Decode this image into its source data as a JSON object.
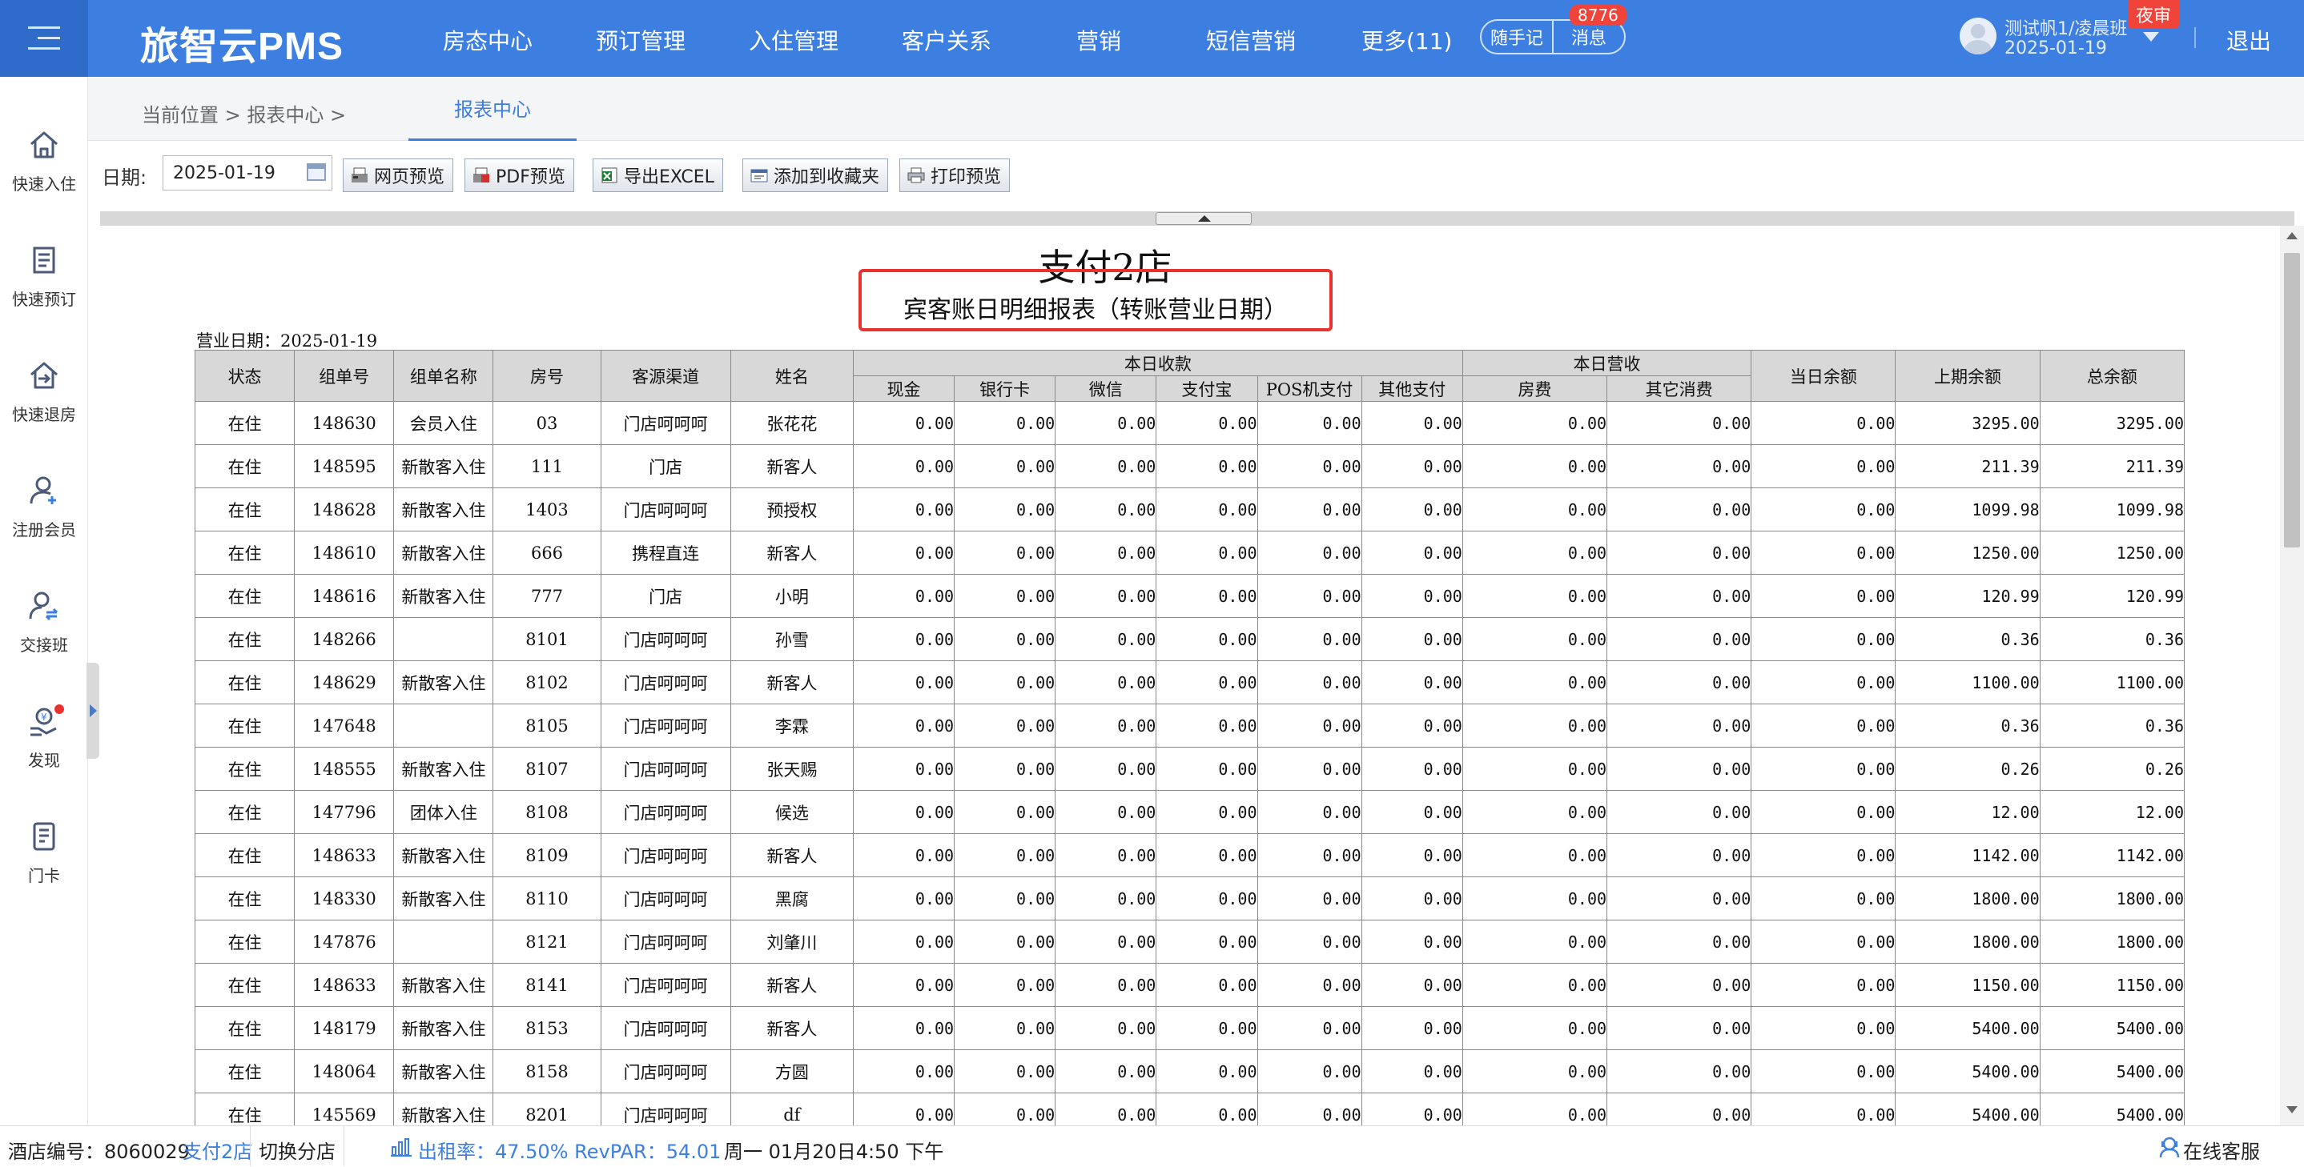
{
  "brand": "旅智云PMS",
  "nav": [
    "房态中心",
    "预订管理",
    "入住管理",
    "客户关系",
    "营销",
    "短信营销",
    "更多(11)"
  ],
  "quick_note": "随手记",
  "messages": {
    "label": "消息",
    "badge": "8776"
  },
  "user": {
    "name": "测试帆1/凌晨班",
    "date": "2025-01-19",
    "badge": "夜审"
  },
  "logout": "退出",
  "sidebar": [
    {
      "label": "快速入住",
      "icon": "home-icon"
    },
    {
      "label": "快速预订",
      "icon": "document-icon"
    },
    {
      "label": "快速退房",
      "icon": "checkout-icon"
    },
    {
      "label": "注册会员",
      "icon": "add-user-icon"
    },
    {
      "label": "交接班",
      "icon": "handover-icon"
    },
    {
      "label": "发现",
      "icon": "discover-icon"
    },
    {
      "label": "门卡",
      "icon": "card-icon"
    }
  ],
  "breadcrumb": {
    "text": "当前位置 > 报表中心 >",
    "active_tab": "报表中心"
  },
  "toolbar": {
    "date_label": "日期:",
    "date_value": "2025-01-19",
    "buttons": [
      "网页预览",
      "PDF预览",
      "导出EXCEL",
      "添加到收藏夹",
      "打印预览"
    ]
  },
  "report": {
    "title": "支付2店",
    "subtitle": "宾客账日明细报表（转账营业日期）",
    "business_date": "营业日期：2025-01-19",
    "group_headers": {
      "receipts": "本日收款",
      "revenue": "本日营收"
    },
    "columns": [
      "状态",
      "组单号",
      "组单名称",
      "房号",
      "客源渠道",
      "姓名",
      "现金",
      "银行卡",
      "微信",
      "支付宝",
      "POS机支付",
      "其他支付",
      "房费",
      "其它消费",
      "当日余额",
      "上期余额",
      "总余额"
    ],
    "rows": [
      [
        "在住",
        "148630",
        "会员入住",
        "03",
        "门店呵呵呵",
        "张花花",
        "0.00",
        "0.00",
        "0.00",
        "0.00",
        "0.00",
        "0.00",
        "0.00",
        "0.00",
        "0.00",
        "3295.00",
        "3295.00"
      ],
      [
        "在住",
        "148595",
        "新散客入住",
        "111",
        "门店",
        "新客人",
        "0.00",
        "0.00",
        "0.00",
        "0.00",
        "0.00",
        "0.00",
        "0.00",
        "0.00",
        "0.00",
        "211.39",
        "211.39"
      ],
      [
        "在住",
        "148628",
        "新散客入住",
        "1403",
        "门店呵呵呵",
        "预授权",
        "0.00",
        "0.00",
        "0.00",
        "0.00",
        "0.00",
        "0.00",
        "0.00",
        "0.00",
        "0.00",
        "1099.98",
        "1099.98"
      ],
      [
        "在住",
        "148610",
        "新散客入住",
        "666",
        "携程直连",
        "新客人",
        "0.00",
        "0.00",
        "0.00",
        "0.00",
        "0.00",
        "0.00",
        "0.00",
        "0.00",
        "0.00",
        "1250.00",
        "1250.00"
      ],
      [
        "在住",
        "148616",
        "新散客入住",
        "777",
        "门店",
        "小明",
        "0.00",
        "0.00",
        "0.00",
        "0.00",
        "0.00",
        "0.00",
        "0.00",
        "0.00",
        "0.00",
        "120.99",
        "120.99"
      ],
      [
        "在住",
        "148266",
        "",
        "8101",
        "门店呵呵呵",
        "孙雪",
        "0.00",
        "0.00",
        "0.00",
        "0.00",
        "0.00",
        "0.00",
        "0.00",
        "0.00",
        "0.00",
        "0.36",
        "0.36"
      ],
      [
        "在住",
        "148629",
        "新散客入住",
        "8102",
        "门店呵呵呵",
        "新客人",
        "0.00",
        "0.00",
        "0.00",
        "0.00",
        "0.00",
        "0.00",
        "0.00",
        "0.00",
        "0.00",
        "1100.00",
        "1100.00"
      ],
      [
        "在住",
        "147648",
        "",
        "8105",
        "门店呵呵呵",
        "李霖",
        "0.00",
        "0.00",
        "0.00",
        "0.00",
        "0.00",
        "0.00",
        "0.00",
        "0.00",
        "0.00",
        "0.36",
        "0.36"
      ],
      [
        "在住",
        "148555",
        "新散客入住",
        "8107",
        "门店呵呵呵",
        "张天赐",
        "0.00",
        "0.00",
        "0.00",
        "0.00",
        "0.00",
        "0.00",
        "0.00",
        "0.00",
        "0.00",
        "0.26",
        "0.26"
      ],
      [
        "在住",
        "147796",
        "团体入住",
        "8108",
        "门店呵呵呵",
        "候选",
        "0.00",
        "0.00",
        "0.00",
        "0.00",
        "0.00",
        "0.00",
        "0.00",
        "0.00",
        "0.00",
        "12.00",
        "12.00"
      ],
      [
        "在住",
        "148633",
        "新散客入住",
        "8109",
        "门店呵呵呵",
        "新客人",
        "0.00",
        "0.00",
        "0.00",
        "0.00",
        "0.00",
        "0.00",
        "0.00",
        "0.00",
        "0.00",
        "1142.00",
        "1142.00"
      ],
      [
        "在住",
        "148330",
        "新散客入住",
        "8110",
        "门店呵呵呵",
        "黑腐",
        "0.00",
        "0.00",
        "0.00",
        "0.00",
        "0.00",
        "0.00",
        "0.00",
        "0.00",
        "0.00",
        "1800.00",
        "1800.00"
      ],
      [
        "在住",
        "147876",
        "",
        "8121",
        "门店呵呵呵",
        "刘肇川",
        "0.00",
        "0.00",
        "0.00",
        "0.00",
        "0.00",
        "0.00",
        "0.00",
        "0.00",
        "0.00",
        "1800.00",
        "1800.00"
      ],
      [
        "在住",
        "148633",
        "新散客入住",
        "8141",
        "门店呵呵呵",
        "新客人",
        "0.00",
        "0.00",
        "0.00",
        "0.00",
        "0.00",
        "0.00",
        "0.00",
        "0.00",
        "0.00",
        "1150.00",
        "1150.00"
      ],
      [
        "在住",
        "148179",
        "新散客入住",
        "8153",
        "门店呵呵呵",
        "新客人",
        "0.00",
        "0.00",
        "0.00",
        "0.00",
        "0.00",
        "0.00",
        "0.00",
        "0.00",
        "0.00",
        "5400.00",
        "5400.00"
      ],
      [
        "在住",
        "148064",
        "新散客入住",
        "8158",
        "门店呵呵呵",
        "方圆",
        "0.00",
        "0.00",
        "0.00",
        "0.00",
        "0.00",
        "0.00",
        "0.00",
        "0.00",
        "0.00",
        "5400.00",
        "5400.00"
      ],
      [
        "在住",
        "145569",
        "新散客入住",
        "8201",
        "门店呵呵呵",
        "df",
        "0.00",
        "0.00",
        "0.00",
        "0.00",
        "0.00",
        "0.00",
        "0.00",
        "0.00",
        "0.00",
        "5400.00",
        "5400.00"
      ]
    ]
  },
  "statusbar": {
    "hotel_label": "酒店编号：8060029",
    "store": "支付2店",
    "switch": "切换分店",
    "occupancy": "出租率：47.50% RevPAR：54.01",
    "time": "周一 01月20日4:50 下午",
    "support": "在线客服"
  },
  "colors": {
    "primary": "#3d7fe0",
    "highlight_border": "#e8322e",
    "badge": "#f0443b"
  }
}
